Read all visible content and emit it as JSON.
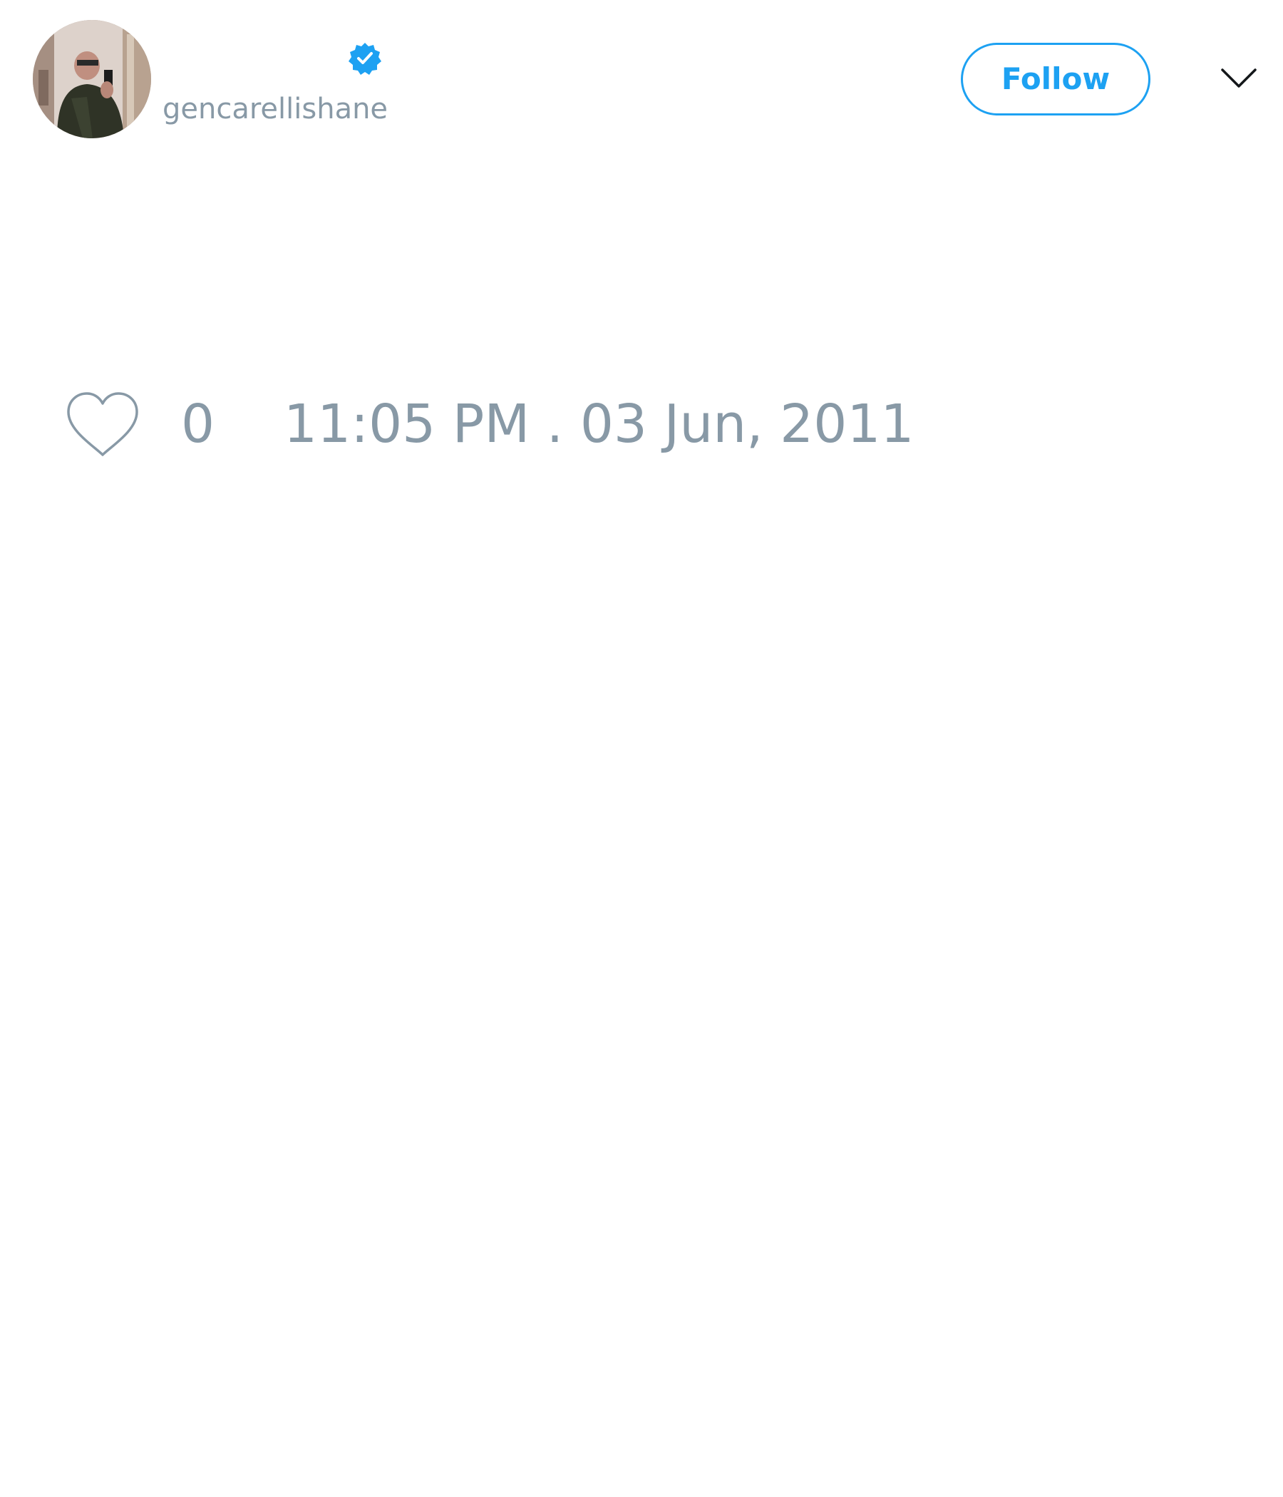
{
  "header": {
    "display_name": "",
    "handle": "gencarellishane",
    "verified": true,
    "avatar_icon": "profile-photo",
    "follow_label": "Follow",
    "menu_icon": "chevron-down-icon"
  },
  "tweet": {
    "text": ""
  },
  "actions": {
    "like_icon": "heart-icon",
    "like_count": "0",
    "timestamp": "11:05 PM . 03 Jun, 2011"
  },
  "colors": {
    "accent": "#1da1f2",
    "muted": "#8899a6",
    "text": "#14171a",
    "background": "#ffffff"
  }
}
